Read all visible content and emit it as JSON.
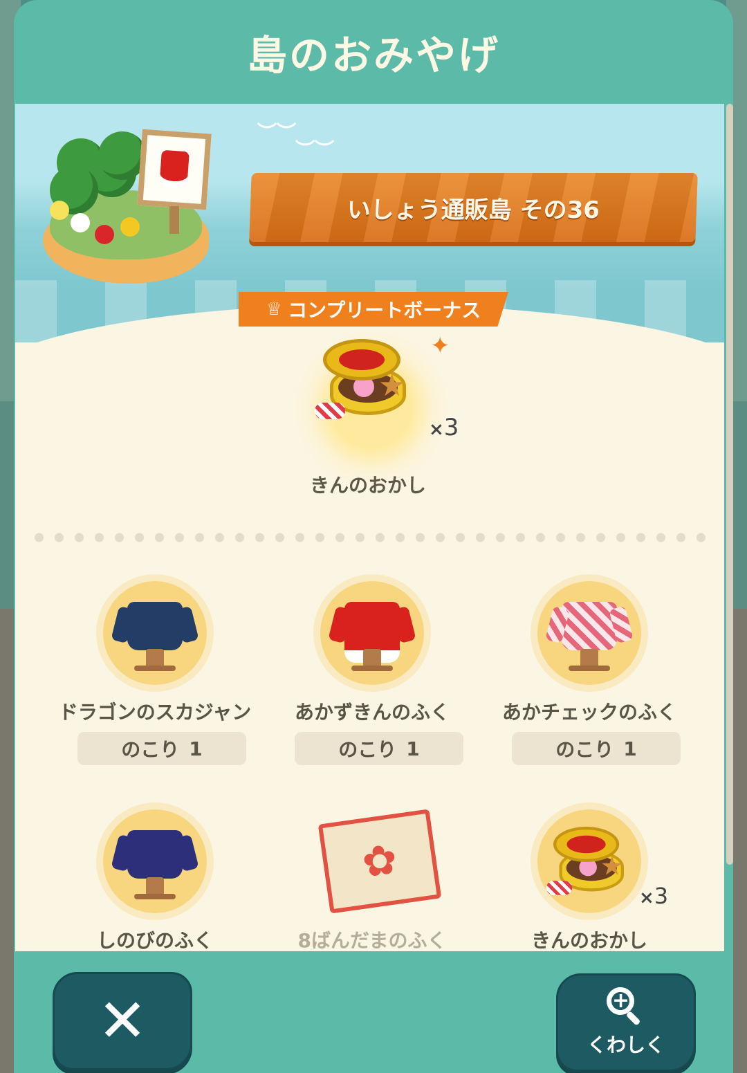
{
  "window": {
    "title": "島のおみやげ"
  },
  "island": {
    "name": "いしょう通販島 その36"
  },
  "bonus": {
    "label": "コンプリートボーナス",
    "reward": {
      "name": "きんのおかし",
      "quantity": "3",
      "icon": "candy-tin-icon"
    }
  },
  "items": [
    {
      "name": "ドラゴンのスカジャン",
      "remaining_label": "のこり",
      "remaining": "1",
      "icon": "dragon-jacket-icon",
      "color": "#243d66"
    },
    {
      "name": "あかずきんのふく",
      "remaining_label": "のこり",
      "remaining": "1",
      "icon": "red-hood-dress-icon",
      "color": "#d9221e"
    },
    {
      "name": "あかチェックのふく",
      "remaining_label": "のこり",
      "remaining": "1",
      "icon": "red-check-dress-icon",
      "color": "#e6677a"
    },
    {
      "name": "しのびのふく",
      "icon": "ninja-outfit-icon",
      "color": "#2d2f7a"
    },
    {
      "name": "8ばんだまのふく",
      "icon": "eightball-outfit-stamp-icon",
      "obtained": true
    },
    {
      "name": "きんのおかし",
      "quantity": "3",
      "icon": "candy-tin-icon"
    }
  ],
  "buttons": {
    "close": "✕",
    "details": "くわしく"
  },
  "colors": {
    "frame": "#5bbba8",
    "accent": "#f07f1e",
    "button": "#1d5a61",
    "panel": "#fbf5e3"
  }
}
